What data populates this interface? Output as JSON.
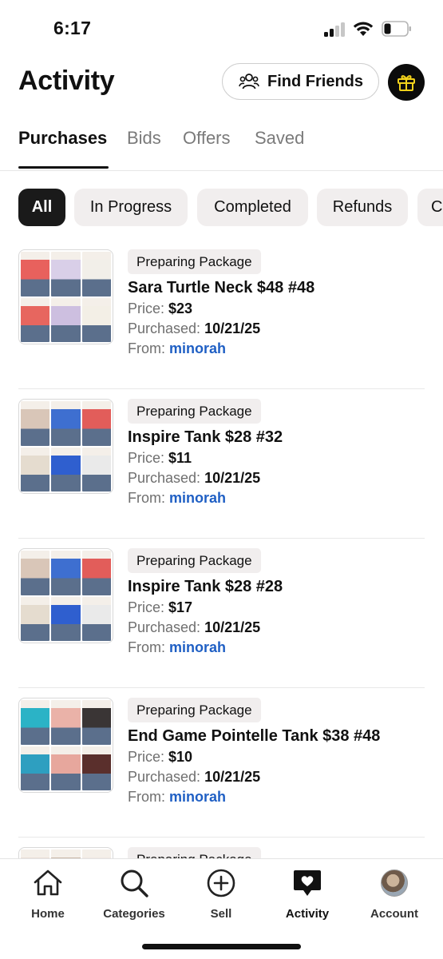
{
  "status_bar": {
    "time": "6:17"
  },
  "header": {
    "title": "Activity",
    "find_friends_label": "Find Friends"
  },
  "tabs": [
    {
      "label": "Purchases",
      "active": true
    },
    {
      "label": "Bids",
      "active": false
    },
    {
      "label": "Offers",
      "active": false
    },
    {
      "label": "Saved",
      "active": false
    }
  ],
  "filters": [
    {
      "label": "All",
      "active": true
    },
    {
      "label": "In Progress",
      "active": false
    },
    {
      "label": "Completed",
      "active": false
    },
    {
      "label": "Refunds",
      "active": false
    },
    {
      "label": "C",
      "active": false
    }
  ],
  "labels": {
    "price": "Price:",
    "purchased": "Purchased:",
    "from": "From:"
  },
  "purchases": [
    {
      "status": "Preparing Package",
      "title": "Sara Turtle Neck $48 #48",
      "price": "$23",
      "purchased": "10/21/25",
      "seller": "minorah",
      "thumb_colors": [
        "#e8615d",
        "#d9cfe8",
        "#f2efe9",
        "#e7665f",
        "#cdbfe0",
        "#f3efe6"
      ]
    },
    {
      "status": "Preparing Package",
      "title": "Inspire Tank $28 #32",
      "price": "$11",
      "purchased": "10/21/25",
      "seller": "minorah",
      "thumb_colors": [
        "#d9c6b8",
        "#3e6fd0",
        "#e25d5a",
        "#e5dccf",
        "#2f5fcf",
        "#eaeaea"
      ]
    },
    {
      "status": "Preparing Package",
      "title": "Inspire Tank $28 #28",
      "price": "$17",
      "purchased": "10/21/25",
      "seller": "minorah",
      "thumb_colors": [
        "#d9c6b8",
        "#3e6fd0",
        "#e25d5a",
        "#e5dccf",
        "#2f5fcf",
        "#eaeaea"
      ]
    },
    {
      "status": "Preparing Package",
      "title": "End Game Pointelle Tank $38 #48",
      "price": "$10",
      "purchased": "10/21/25",
      "seller": "minorah",
      "thumb_colors": [
        "#2bb3c6",
        "#eab2a8",
        "#3a3535",
        "#2e9fc0",
        "#e7a79d",
        "#5a2f2c"
      ]
    },
    {
      "status": "Preparing Package",
      "title": "",
      "price": "",
      "purchased": "",
      "seller": "",
      "thumb_colors": [
        "#e9ddd6",
        "#c9b7a8",
        "#efe7e1",
        "#e9ddd6",
        "#c9b7a8",
        "#efe7e1"
      ]
    }
  ],
  "bottom_nav": [
    {
      "label": "Home",
      "icon": "home-icon"
    },
    {
      "label": "Categories",
      "icon": "search-icon"
    },
    {
      "label": "Sell",
      "icon": "plus-circle-icon"
    },
    {
      "label": "Activity",
      "icon": "heart-bubble-icon",
      "active": true
    },
    {
      "label": "Account",
      "icon": "avatar"
    }
  ],
  "colors": {
    "accent_link": "#1f5fc4",
    "chip_bg": "#f1eeee",
    "gift_icon": "#f2d21b"
  }
}
